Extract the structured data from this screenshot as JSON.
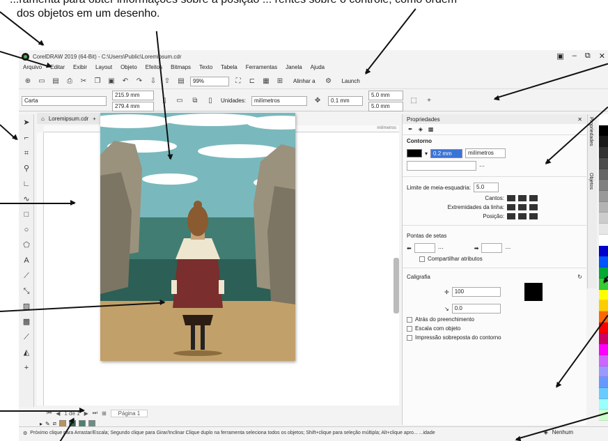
{
  "caption": {
    "line1": "...ramenta para obter informações sobre a posição ... rentes sobre o controle, como ordem",
    "line2": "dos objetos em um desenho."
  },
  "window": {
    "title": "CorelDRAW 2019 (64-Bit) - C:\\Users\\Public\\Loremipsum.cdr"
  },
  "menu": [
    "Arquivo",
    "Editar",
    "Exibir",
    "Layout",
    "Objeto",
    "Efeitos",
    "Bitmaps",
    "Texto",
    "Tabela",
    "Ferramentas",
    "Janela",
    "Ajuda"
  ],
  "toolbar": {
    "zoom": "99%",
    "align_label": "Alinhar a",
    "launch_label": "Launch"
  },
  "propbar": {
    "page_type": "Carta",
    "width": "215.9 mm",
    "height": "279.4 mm",
    "units_label": "Unidades:",
    "units_value": "milímetros",
    "nudge": "0.1 mm",
    "dup_x": "5.0 mm",
    "dup_y": "5.0 mm"
  },
  "document": {
    "tab": "Loremipsum.cdr",
    "ruler_units": "milímetros",
    "page_count_label": "1 de 1",
    "page_tab": "Página 1"
  },
  "docker": {
    "title": "Propriedades",
    "outline_section": "Contorno",
    "width_value": "0.2 mm",
    "width_units": "milímetros",
    "miter_label": "Limite de meia-esquadria:",
    "miter_value": "5.0",
    "corners_label": "Cantos:",
    "line_caps_label": "Extremidades da linha:",
    "position_label": "Posição:",
    "arrowheads_section": "Pontas de setas",
    "share_attributes": "Compartilhar atributos",
    "calligraphy_section": "Caligrafia",
    "stretch_value": "100",
    "angle_value": "0.0",
    "behind_fill": "Atrás do preenchimento",
    "scale_with_object": "Escala com objeto",
    "overprint": "Impressão sobreposta do contorno"
  },
  "side_tabs": [
    "Propriedades",
    "Objetos"
  ],
  "status": {
    "text": "Próximo clique para Arrastar/Escala; Segundo clique para Girar/Inclinar Clique duplo na ferramenta seleciona todos os objetos; Shift+clique para seleção múltipla; Alt+clique apro... ...idade",
    "fill_label": "Nenhum"
  },
  "palette_colors": [
    "#ffffff",
    "#000000",
    "#1a1a1a",
    "#333333",
    "#4d4d4d",
    "#666666",
    "#808080",
    "#999999",
    "#b3b3b3",
    "#cccccc",
    "#e6e6e6",
    "#ffffff",
    "#0000cc",
    "#0055ff",
    "#00aa33",
    "#33cc33",
    "#ffff00",
    "#ffcc00",
    "#ff6600",
    "#ff0000",
    "#cc0066",
    "#ff00ff",
    "#cc66ff",
    "#9999ff",
    "#6699ff",
    "#66ccff",
    "#99ffff",
    "#ccffcc"
  ],
  "doc_palette": [
    "#b8935a",
    "#2f5f55",
    "#4f7f72",
    "#6a8f87"
  ]
}
